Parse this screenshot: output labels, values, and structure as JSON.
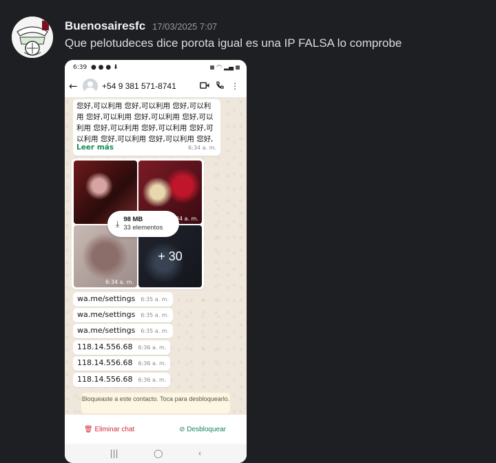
{
  "message": {
    "username": "Buenosairesfc",
    "timestamp": "17/03/2025 7:07",
    "content": "Que pelotudeces dice porota igual es una IP FALSA lo comprobe"
  },
  "screenshot": {
    "status_time": "6:39",
    "contact_phone": "+54 9 381 571-8741",
    "text_message": {
      "body": "您好,可以利用 您好,可以利用 您好,可以利用 您好,可以利用 您好,可以利用 您好,可以利用 您好,可以利用 您好,可以利用 您好,可以利用 您好,可以利用 您好,可以利用 您好,可以利用 ...",
      "read_more": "Leer más",
      "time": "6:34 a. m."
    },
    "media": {
      "tile2_time": "6:34 a. m.",
      "tile3_time": "6:34 a. m.",
      "more_count": "+ 30",
      "download_size": "98 MB",
      "download_count": "33 elementos"
    },
    "messages": [
      {
        "text": "wa.me/settings",
        "time": "6:35 a. m."
      },
      {
        "text": "wa.me/settings",
        "time": "6:35 a. m."
      },
      {
        "text": "wa.me/settings",
        "time": "6:35 a. m."
      },
      {
        "text": "118.14.556.68",
        "time": "6:36 a. m."
      },
      {
        "text": "118.14.556.68",
        "time": "6:36 a. m."
      },
      {
        "text": "118.14.556.68",
        "time": "6:36 a. m."
      }
    ],
    "blocked_notice": "Bloqueaste a este contacto. Toca para desbloquearlo.",
    "delete_chat": "Eliminar chat",
    "unblock": "Desbloquear"
  },
  "colors": {
    "background": "#1e1f22",
    "username": "#f2f3f5",
    "whatsapp_green": "#14865a",
    "danger_red": "#d02a3a"
  }
}
